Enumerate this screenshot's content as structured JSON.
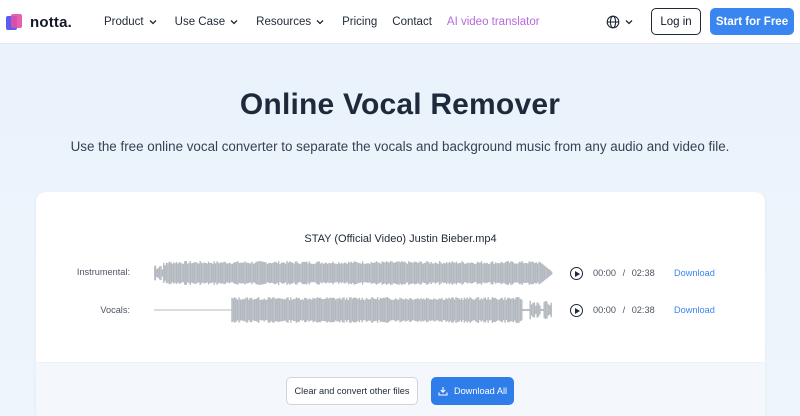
{
  "brand": {
    "name": "notta."
  },
  "nav": {
    "items": [
      {
        "label": "Product",
        "has_dropdown": true
      },
      {
        "label": "Use Case",
        "has_dropdown": true
      },
      {
        "label": "Resources",
        "has_dropdown": true
      },
      {
        "label": "Pricing",
        "has_dropdown": false
      },
      {
        "label": "Contact",
        "has_dropdown": false
      },
      {
        "label": "AI video translator",
        "has_dropdown": false
      }
    ],
    "language_icon": "globe-icon",
    "login_label": "Log in",
    "start_label": "Start for Free"
  },
  "hero": {
    "title": "Online Vocal Remover",
    "subtitle": "Use the free online vocal converter to separate the vocals and background music from any audio and video file."
  },
  "result": {
    "filename": "STAY (Official Video) Justin Bieber.mp4",
    "tracks": [
      {
        "label": "Instrumental:",
        "current": "00:00",
        "separator": "/",
        "duration": "02:38",
        "download_label": "Download"
      },
      {
        "label": "Vocals:",
        "current": "00:00",
        "separator": "/",
        "duration": "02:38",
        "download_label": "Download"
      }
    ],
    "clear_label": "Clear and convert other files",
    "download_all_label": "Download All"
  },
  "colors": {
    "accent": "#3a86f0",
    "ai_link": "#b56adf",
    "waveform": "#b4b9c0",
    "background": "#e9f2fb"
  }
}
